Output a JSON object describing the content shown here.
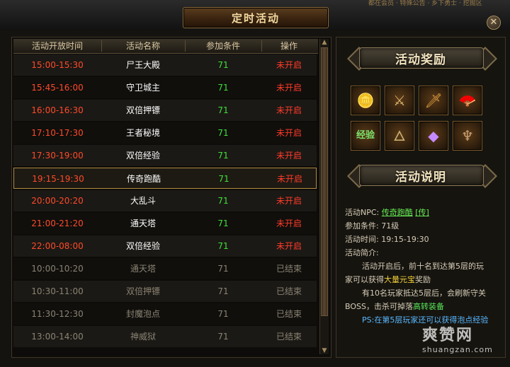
{
  "window": {
    "title": "定时活动",
    "top_strip": "都在会员 · 特殊公告 · 乡下勇士 · 挖掘区",
    "close_label": "✕"
  },
  "table": {
    "headers": {
      "time": "活动开放时间",
      "name": "活动名称",
      "condition": "参加条件",
      "action": "操作"
    },
    "rows": [
      {
        "time": "15:00-15:30",
        "name": "尸王大殿",
        "condition": "71",
        "action": "未开启",
        "status": "upcoming"
      },
      {
        "time": "15:45-16:00",
        "name": "守卫城主",
        "condition": "71",
        "action": "未开启",
        "status": "upcoming"
      },
      {
        "time": "16:00-16:30",
        "name": "双倍押镖",
        "condition": "71",
        "action": "未开启",
        "status": "upcoming"
      },
      {
        "time": "17:10-17:30",
        "name": "王者秘境",
        "condition": "71",
        "action": "未开启",
        "status": "upcoming"
      },
      {
        "time": "17:30-19:00",
        "name": "双倍经验",
        "condition": "71",
        "action": "未开启",
        "status": "upcoming"
      },
      {
        "time": "19:15-19:30",
        "name": "传奇跑酷",
        "condition": "71",
        "action": "未开启",
        "status": "upcoming",
        "selected": true
      },
      {
        "time": "20:00-20:20",
        "name": "大乱斗",
        "condition": "71",
        "action": "未开启",
        "status": "upcoming"
      },
      {
        "time": "21:00-21:20",
        "name": "通天塔",
        "condition": "71",
        "action": "未开启",
        "status": "upcoming"
      },
      {
        "time": "22:00-08:00",
        "name": "双倍经验",
        "condition": "71",
        "action": "未开启",
        "status": "upcoming"
      },
      {
        "time": "10:00-10:20",
        "name": "通天塔",
        "condition": "71",
        "action": "已结束",
        "status": "ended"
      },
      {
        "time": "10:30-11:00",
        "name": "双倍押镖",
        "condition": "71",
        "action": "已结束",
        "status": "ended"
      },
      {
        "time": "11:30-12:30",
        "name": "封魔泡点",
        "condition": "71",
        "action": "已结束",
        "status": "ended"
      },
      {
        "time": "13:00-14:00",
        "name": "神威狱",
        "condition": "71",
        "action": "已结束",
        "status": "ended"
      }
    ]
  },
  "rewards": {
    "title": "活动奖励",
    "items": [
      {
        "icon": "gold-ingot-icon",
        "glyph": "🪙"
      },
      {
        "icon": "sword-icon",
        "glyph": "⚔"
      },
      {
        "icon": "blade-icon",
        "glyph": "🗡"
      },
      {
        "icon": "fan-icon",
        "glyph": "🪭"
      },
      {
        "icon": "exp-orb-icon",
        "glyph": "经验"
      },
      {
        "icon": "green-talisman-icon",
        "glyph": "🜂"
      },
      {
        "icon": "purple-gem-icon",
        "glyph": "◆"
      },
      {
        "icon": "horn-icon",
        "glyph": "♆"
      }
    ]
  },
  "description": {
    "title": "活动说明",
    "npc_label": "活动NPC:",
    "npc_name": "传奇跑酷",
    "npc_link": "[传]",
    "condition_label": "参加条件:",
    "condition_value": "71级",
    "time_label": "活动时间:",
    "time_value": "19:15-19:30",
    "intro_label": "活动简介:",
    "intro_1a": "活动开启后，前十名到达第5层的玩",
    "intro_1b": "家可以获得",
    "intro_1c": "大量元宝",
    "intro_1d": "奖励",
    "intro_2a": "有10名玩家抵达5层后，会刷新守关",
    "intro_2b": "BOSS，击杀可掉落",
    "intro_2c": "高转装备",
    "ps": "PS:在第5层玩家还可以获得泡点经验"
  },
  "watermark": {
    "logo": "爽赞网",
    "url": "shuangzan.com"
  },
  "colors": {
    "time_upcoming": "#ff4a2a",
    "time_ended": "#8a8373",
    "name_active": "#ffffff",
    "name_ended": "#8a8373",
    "cond_active": "#3fe03a",
    "cond_ended": "#8a8373",
    "op_upcoming": "#ff3a2a",
    "op_ended": "#8a8373"
  }
}
